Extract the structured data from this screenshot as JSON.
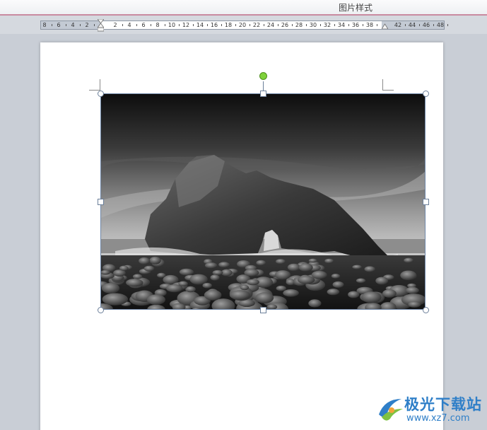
{
  "ribbon": {
    "active_tab": "图片样式"
  },
  "ruler": {
    "labels": [
      "8",
      "6",
      "4",
      "2",
      "2",
      "4",
      "6",
      "8",
      "10",
      "12",
      "14",
      "16",
      "18",
      "20",
      "22",
      "24",
      "26",
      "28",
      "30",
      "32",
      "34",
      "36",
      "38",
      "42",
      "44",
      "46",
      "48"
    ]
  },
  "document": {
    "image_description_icon": "photo-rock-arch-grayscale"
  },
  "watermark": {
    "logo_text": "极光下载站",
    "url": "www.xz7.com"
  },
  "colors": {
    "accent_line": "#c98aa0",
    "rotate_handle": "#7fd13b",
    "watermark": "#2f7fc8"
  }
}
